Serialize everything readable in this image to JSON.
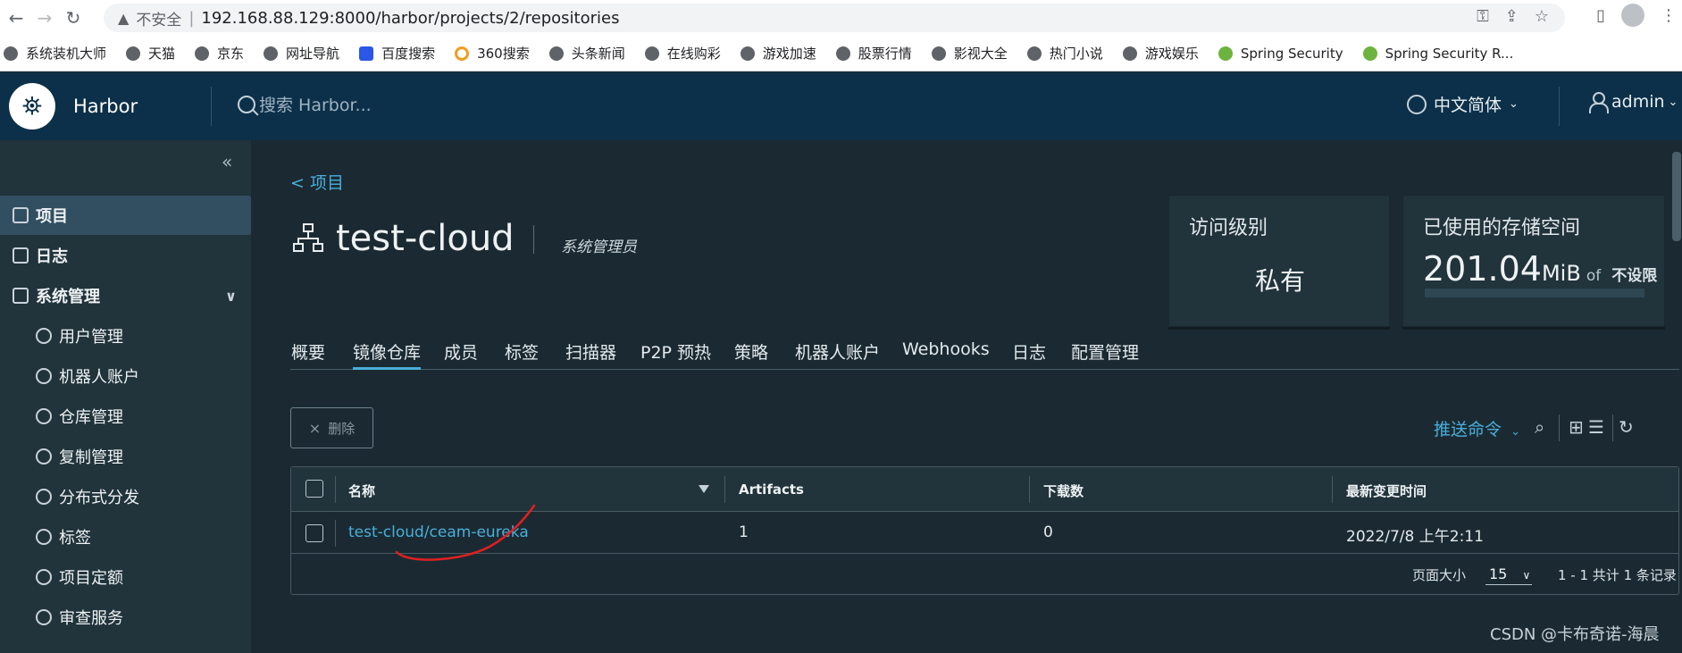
{
  "browser": {
    "insecure_label": "不安全",
    "url": "192.168.88.129:8000/harbor/projects/2/repositories",
    "bookmarks": [
      {
        "label": "系统装机大师",
        "icon": "bird-icon"
      },
      {
        "label": "天猫",
        "icon": "globe-icon"
      },
      {
        "label": "京东",
        "icon": "globe-icon"
      },
      {
        "label": "网址导航",
        "icon": "globe-icon"
      },
      {
        "label": "百度搜索",
        "icon": "paw-icon"
      },
      {
        "label": "360搜索",
        "icon": "ring-icon"
      },
      {
        "label": "头条新闻",
        "icon": "globe-icon"
      },
      {
        "label": "在线购彩",
        "icon": "globe-icon"
      },
      {
        "label": "游戏加速",
        "icon": "globe-icon"
      },
      {
        "label": "股票行情",
        "icon": "globe-icon"
      },
      {
        "label": "影视大全",
        "icon": "globe-icon"
      },
      {
        "label": "热门小说",
        "icon": "globe-icon"
      },
      {
        "label": "游戏娱乐",
        "icon": "globe-icon"
      },
      {
        "label": "Spring Security",
        "icon": "spring-icon"
      },
      {
        "label": "Spring Security R...",
        "icon": "spring-icon"
      }
    ]
  },
  "header": {
    "brand": "Harbor",
    "search_placeholder": "搜索 Harbor...",
    "language": "中文简体",
    "user": "admin"
  },
  "sidebar": {
    "items": [
      {
        "label": "项目",
        "icon": "project-icon"
      },
      {
        "label": "日志",
        "icon": "log-icon"
      },
      {
        "label": "系统管理",
        "icon": "admin-icon"
      },
      {
        "label": "用户管理",
        "icon": "users-icon"
      },
      {
        "label": "机器人账户",
        "icon": "robot-icon"
      },
      {
        "label": "仓库管理",
        "icon": "registry-icon"
      },
      {
        "label": "复制管理",
        "icon": "replication-icon"
      },
      {
        "label": "分布式分发",
        "icon": "share-icon"
      },
      {
        "label": "标签",
        "icon": "tag-icon"
      },
      {
        "label": "项目定额",
        "icon": "quota-icon"
      },
      {
        "label": "审查服务",
        "icon": "shield-icon"
      }
    ]
  },
  "project": {
    "back_label": "< 项目",
    "name": "test-cloud",
    "role": "系统管理员",
    "access_label": "访问级别",
    "access_value": "私有",
    "storage_label": "已使用的存储空间",
    "storage_value": "201.04",
    "storage_unit": "MiB",
    "storage_of": "of",
    "storage_limit": "不设限"
  },
  "tabs": [
    "概要",
    "镜像仓库",
    "成员",
    "标签",
    "扫描器",
    "P2P 预热",
    "策略",
    "机器人账户",
    "Webhooks",
    "日志",
    "配置管理"
  ],
  "toolbar": {
    "delete_label": "删除",
    "push_command": "推送命令"
  },
  "table": {
    "columns": [
      "名称",
      "Artifacts",
      "下载数",
      "最新变更时间"
    ],
    "rows": [
      {
        "name": "test-cloud/ceam-eureka",
        "artifacts": "1",
        "downloads": "0",
        "updated": "2022/7/8 上午2:11"
      }
    ],
    "page_size_label": "页面大小",
    "page_size": "15",
    "page_info": "1 - 1 共计 1 条记录"
  },
  "watermark": "CSDN @卡布奇诺-海晨"
}
